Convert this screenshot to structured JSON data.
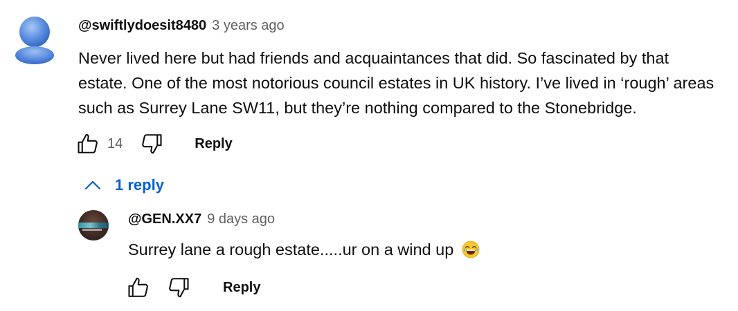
{
  "comment": {
    "author": "@swiftlydoesit8480",
    "time": "3 years ago",
    "text": "Never lived here but had friends and acquaintances that did. So fascinated by that estate. One of the most notorious council estates in UK history. I’ve lived in ‘rough’ areas such as Surrey Lane SW11, but they’re nothing compared to the Stonebridge.",
    "likes": "14",
    "reply_label": "Reply",
    "replies_toggle": "1 reply"
  },
  "reply": {
    "author": "@GEN.XX7",
    "time": "9 days ago",
    "text": "Surrey lane a rough estate.....ur on a wind up",
    "emoji": "face-with-tears-of-joy",
    "reply_label": "Reply"
  },
  "colors": {
    "link_blue": "#065fd4",
    "secondary_text": "#606060",
    "avatar_blue": "#4a7fd6"
  }
}
